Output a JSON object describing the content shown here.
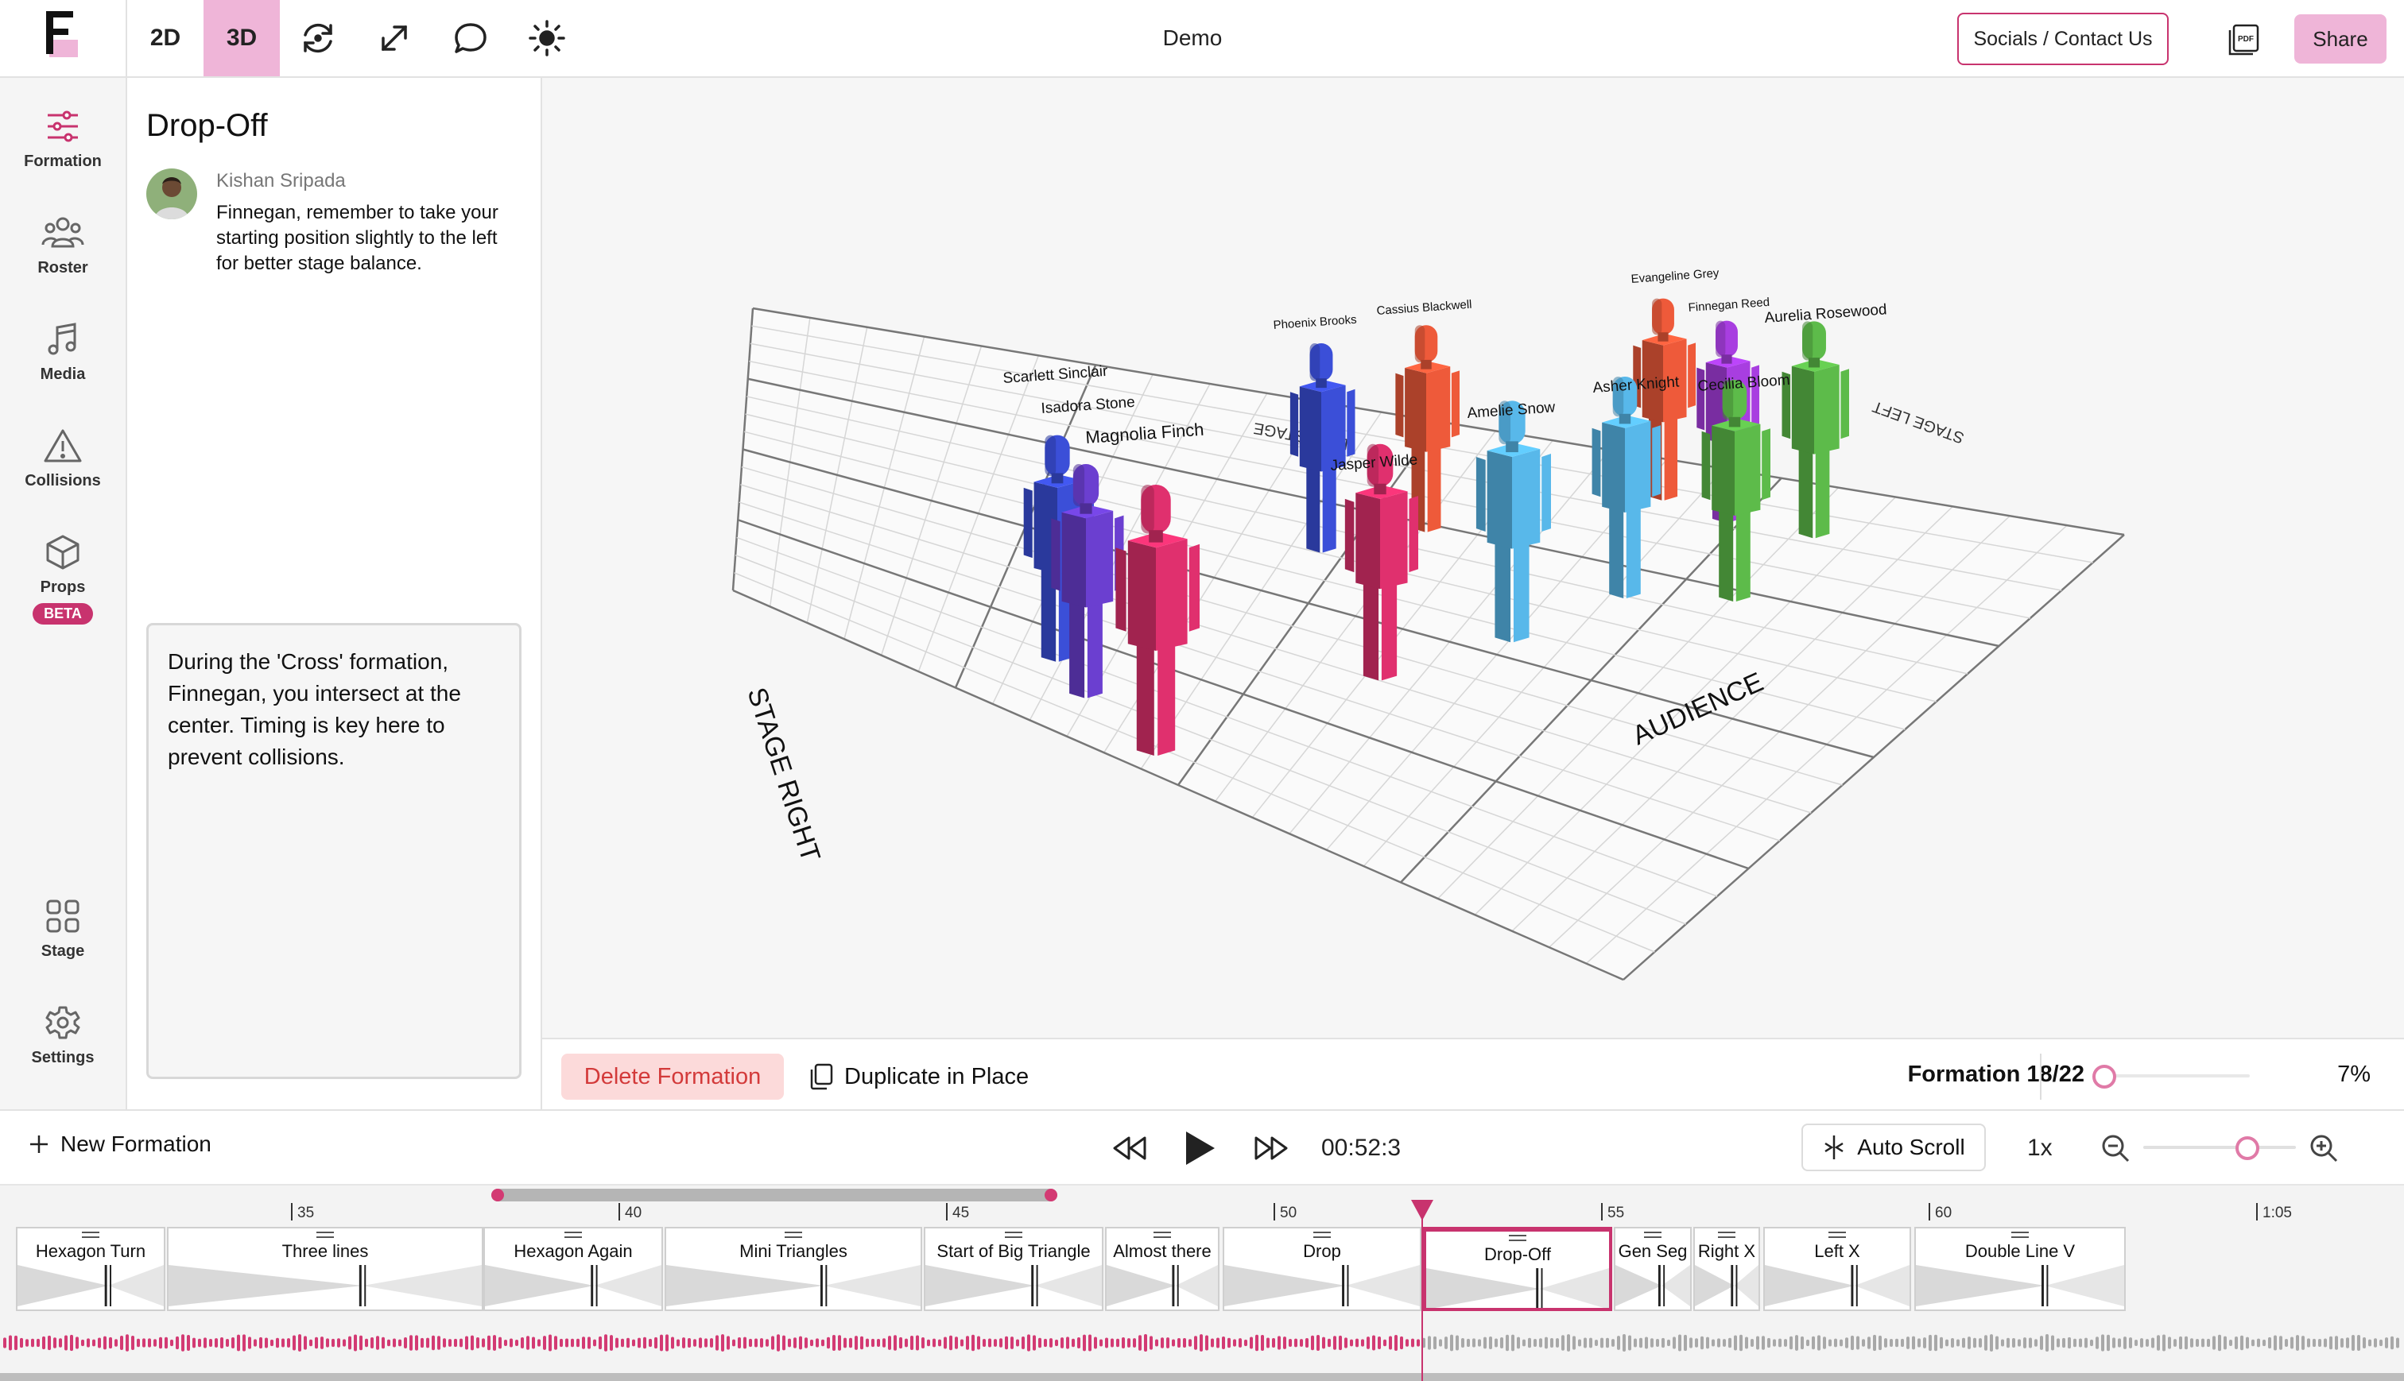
{
  "app": {
    "logo_letter": "F",
    "title": "Demo",
    "accent_color": "#c8336e",
    "accent_light": "#efb5d8"
  },
  "toolbar": {
    "view_2d": "2D",
    "view_3d": "3D",
    "icons": [
      "rotate-icon",
      "expand-icon",
      "comment-icon",
      "brightness-icon"
    ],
    "socials_label": "Socials / Contact Us",
    "pdf_label": "PDF",
    "share_label": "Share"
  },
  "nav": {
    "items": [
      {
        "label": "Formation",
        "icon": "sliders-icon",
        "active": true
      },
      {
        "label": "Roster",
        "icon": "people-icon"
      },
      {
        "label": "Media",
        "icon": "music-icon"
      },
      {
        "label": "Collisions",
        "icon": "warning-icon"
      },
      {
        "label": "Props",
        "icon": "cube-icon",
        "badge": "BETA"
      },
      {
        "label": "Stage",
        "icon": "grid-icon"
      },
      {
        "label": "Settings",
        "icon": "gear-icon"
      }
    ]
  },
  "formation_panel": {
    "title": "Drop-Off",
    "comment_author": "Kishan Sripada",
    "comment_text": "Finnegan, remember to take your starting position slightly to the left for better stage balance.",
    "notes": "During the 'Cross' formation, Finnegan, you intersect at the center. Timing is key here to prevent collisions."
  },
  "stage": {
    "labels": {
      "audience": "AUDIENCE",
      "stage_right": "STAGE RIGHT",
      "stage_left": "STAGE LEFT",
      "backstage": "BACKSTAGE"
    },
    "dancers": [
      {
        "name": "Scarlett Sinclair",
        "color": "#3b4fd8"
      },
      {
        "name": "Isadora Stone",
        "color": "#6b3fd0"
      },
      {
        "name": "Magnolia Finch",
        "color": "#e0306e"
      },
      {
        "name": "Phoenix Brooks",
        "color": "#3b4fd8"
      },
      {
        "name": "Cassius Blackwell",
        "color": "#ee5a3a"
      },
      {
        "name": "Jasper Wilde",
        "color": "#e0306e"
      },
      {
        "name": "Amelie Snow",
        "color": "#58b8ea"
      },
      {
        "name": "Asher Knight",
        "color": "#58b8ea"
      },
      {
        "name": "Evangeline Grey",
        "color": "#ee5a3a"
      },
      {
        "name": "Finnegan Reed",
        "color": "#a83ee0"
      },
      {
        "name": "Cecilia Bloom",
        "color": "#5dbb4a"
      },
      {
        "name": "Aurelia Rosewood",
        "color": "#5dbb4a"
      }
    ]
  },
  "actions": {
    "delete_label": "Delete Formation",
    "duplicate_label": "Duplicate in Place",
    "formation_counter": "Formation 18/22",
    "zoom_percent": "7%",
    "zoom_value": 0.07
  },
  "playback": {
    "new_formation_label": "New Formation",
    "timecode": "00:52:3",
    "autoscroll_label": "Auto Scroll",
    "speed": "1x",
    "timeline_zoom_level": 0.72
  },
  "timeline": {
    "ticks": [
      "35",
      "40",
      "45",
      "50",
      "55",
      "60",
      "1:05"
    ],
    "formations": [
      {
        "name": "Hexagon Turn"
      },
      {
        "name": "Three lines"
      },
      {
        "name": "Hexagon Again"
      },
      {
        "name": "Mini Triangles"
      },
      {
        "name": "Start of Big Triangle"
      },
      {
        "name": "Almost there"
      },
      {
        "name": "Drop"
      },
      {
        "name": "Drop-Off",
        "active": true
      },
      {
        "name": "Gen Seg"
      },
      {
        "name": "Right X"
      },
      {
        "name": "Left X"
      },
      {
        "name": "Double Line V"
      }
    ]
  }
}
